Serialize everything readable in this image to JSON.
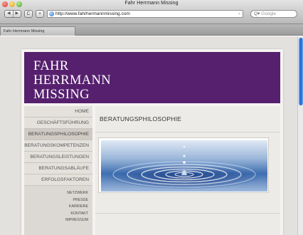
{
  "browser": {
    "window_title": "Fahr Herrmann Missing",
    "nav_back": "◀",
    "nav_forward": "▶",
    "reload_glyph": "C",
    "add_bookmark_glyph": "+",
    "url": "http://www.fahrhermannmissing.com",
    "rss_glyph": "⌄",
    "search_placeholder": "Google",
    "search_icon_glyph": "Q▾",
    "tab_title": "Fahr Herrmann Missing"
  },
  "site": {
    "logo": {
      "line1": "FAHR",
      "line2": "HERRMANN",
      "line3": "MISSING"
    },
    "colors": {
      "header": "#56206e",
      "sidebar": "#dcd9d4",
      "content": "#edebe8"
    },
    "menu": [
      {
        "label": "HOME"
      },
      {
        "label": "GESCHÄFTSFÜHRUNG"
      },
      {
        "label": "BERATUNGSPHILOSOPHIE",
        "active": true
      },
      {
        "label": "BERATUNGSKOMPETENZEN"
      },
      {
        "label": "BERATUNGSLEISTUNGEN"
      },
      {
        "label": "BERATUNGSABLÄUFE"
      },
      {
        "label": "ERFOLGSFAKTOREN"
      }
    ],
    "submenu": [
      {
        "label": "NETZWERK"
      },
      {
        "label": "PRESSE"
      },
      {
        "label": "KARRIERE"
      },
      {
        "label": "KONTAKT"
      },
      {
        "label": "IMPRESSUM"
      }
    ],
    "content": {
      "heading": "BERATUNGSPHILOSOPHIE",
      "image": "water-droplet-ripples"
    }
  }
}
